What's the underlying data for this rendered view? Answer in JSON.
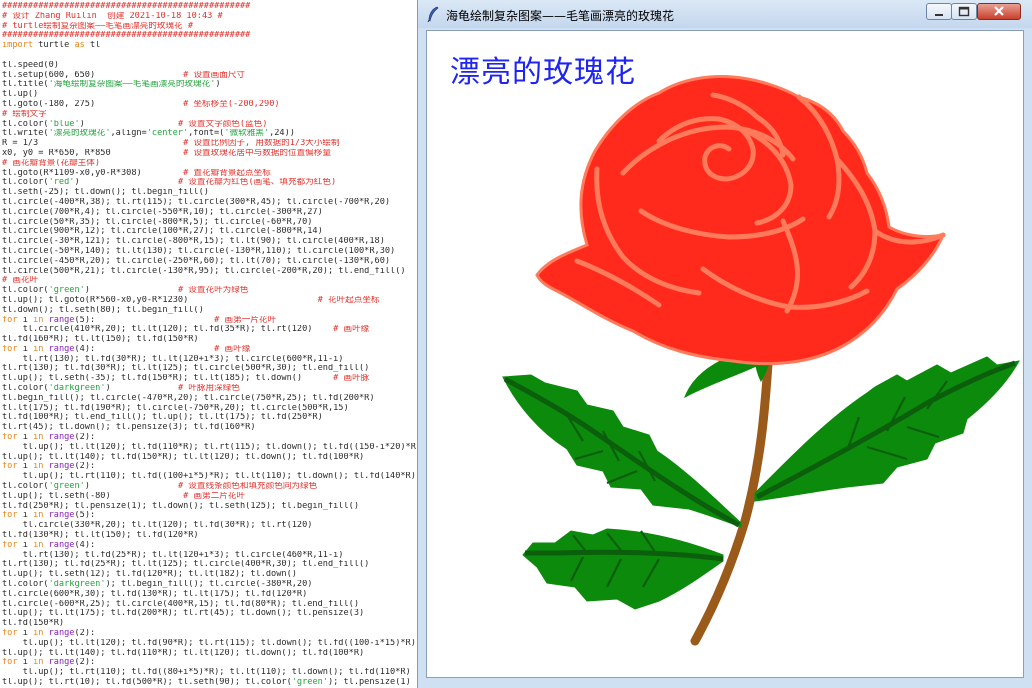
{
  "editor": {
    "lines": [
      [
        [
          "c",
          "################################################"
        ]
      ],
      [
        [
          "c",
          "# 设计 Zhang Ruilin  创建 2021-10-18 10:43 #"
        ]
      ],
      [
        [
          "c",
          "# turtle绘制复杂图案——毛笔画漂亮的玫瑰花 #"
        ]
      ],
      [
        [
          "c",
          "################################################"
        ]
      ],
      [
        [
          "k",
          "import"
        ],
        [
          "n",
          " turtle "
        ],
        [
          "k",
          "as"
        ],
        [
          "n",
          " tl"
        ]
      ],
      [
        [
          "n",
          ""
        ]
      ],
      [
        [
          "n",
          "tl.speed(0)"
        ]
      ],
      [
        [
          "n",
          "tl.setup(600, 650)                 "
        ],
        [
          "c",
          "# 设置画面尺寸"
        ]
      ],
      [
        [
          "n",
          "tl.title("
        ],
        [
          "s",
          "'海龟绘制复杂图案——毛笔画漂亮的玫瑰花'"
        ],
        [
          "n",
          ")"
        ]
      ],
      [
        [
          "n",
          "tl.up()"
        ]
      ],
      [
        [
          "n",
          "tl.goto(-180, 275)                 "
        ],
        [
          "c",
          "# 坐标移至(-200,290)"
        ]
      ],
      [
        [
          "c",
          "# 绘制文字"
        ]
      ],
      [
        [
          "n",
          "tl.color("
        ],
        [
          "s",
          "'blue'"
        ],
        [
          "n",
          ")                  "
        ],
        [
          "c",
          "# 设置文字颜色(蓝色)"
        ]
      ],
      [
        [
          "n",
          "tl.write("
        ],
        [
          "s",
          "'漂亮的玫瑰花'"
        ],
        [
          "n",
          ",align="
        ],
        [
          "s",
          "'center'"
        ],
        [
          "n",
          ",font=("
        ],
        [
          "s",
          "'微软雅黑'"
        ],
        [
          "n",
          ",24))"
        ]
      ],
      [
        [
          "n",
          "R = 1/3                            "
        ],
        [
          "c",
          "# 设置比例因子, 用数据的1/3大小绘制"
        ]
      ],
      [
        [
          "n",
          "x0, y0 = R*650, R*850              "
        ],
        [
          "c",
          "# 设置玫瑰花居中与数据的位置偏移量"
        ]
      ],
      [
        [
          "c",
          "# 画花瓣背景(花瓣主体)"
        ]
      ],
      [
        [
          "n",
          "tl.goto(R*1109-x0,y0-R*308)        "
        ],
        [
          "c",
          "# 置花瓣背景起点坐标"
        ]
      ],
      [
        [
          "n",
          "tl.color("
        ],
        [
          "s",
          "'red'"
        ],
        [
          "n",
          ")                   "
        ],
        [
          "c",
          "# 设置花瓣为红色(画笔、填充都为红色)"
        ]
      ],
      [
        [
          "n",
          "tl.seth(-25); tl.down(); tl.begin_fill()"
        ]
      ],
      [
        [
          "n",
          "tl.circle(-400*R,38); tl.rt(115); tl.circle(300*R,45); tl.circle(-700*R,20)"
        ]
      ],
      [
        [
          "n",
          "tl.circle(700*R,4); tl.circle(-550*R,10); tl.circle(-300*R,27)"
        ]
      ],
      [
        [
          "n",
          "tl.circle(50*R,35); tl.circle(-800*R,5); tl.circle(-60*R,70)"
        ]
      ],
      [
        [
          "n",
          "tl.circle(900*R,12); tl.circle(100*R,27); tl.circle(-800*R,14)"
        ]
      ],
      [
        [
          "n",
          "tl.circle(-30*R,121); tl.circle(-800*R,15); tl.lt(90); tl.circle(400*R,18)"
        ]
      ],
      [
        [
          "n",
          "tl.circle(-50*R,140); tl.lt(130); tl.circle(-130*R,110); tl.circle(100*R,30)"
        ]
      ],
      [
        [
          "n",
          "tl.circle(-450*R,20); tl.circle(-250*R,60); tl.lt(70); tl.circle(-130*R,60)"
        ]
      ],
      [
        [
          "n",
          "tl.circle(500*R,21); tl.circle(-130*R,95); tl.circle(-200*R,20); tl.end_fill()"
        ]
      ],
      [
        [
          "c",
          "# 画花叶"
        ]
      ],
      [
        [
          "n",
          "tl.color("
        ],
        [
          "s",
          "'green'"
        ],
        [
          "n",
          ")                 "
        ],
        [
          "c",
          "# 设置花叶为绿色"
        ]
      ],
      [
        [
          "n",
          "tl.up(); tl.goto(R*560-x0,y0-R*1230)                         "
        ],
        [
          "c",
          "# 花叶起点坐标"
        ]
      ],
      [
        [
          "n",
          "tl.down(); tl.seth(80); tl.begin_fill()"
        ]
      ],
      [
        [
          "k",
          "for"
        ],
        [
          "n",
          " i "
        ],
        [
          "k",
          "in"
        ],
        [
          "p",
          " range"
        ],
        [
          "n",
          "(5):                       "
        ],
        [
          "c",
          "# 画第一片花叶"
        ]
      ],
      [
        [
          "n",
          "    tl.circle(410*R,20); tl.lt(120); tl.fd(35*R); tl.rt(120)    "
        ],
        [
          "c",
          "# 画叶缘"
        ]
      ],
      [
        [
          "n",
          "tl.fd(160*R); tl.lt(150); tl.fd(150*R)"
        ]
      ],
      [
        [
          "k",
          "for"
        ],
        [
          "n",
          " i "
        ],
        [
          "k",
          "in"
        ],
        [
          "p",
          " range"
        ],
        [
          "n",
          "(4):                       "
        ],
        [
          "c",
          "# 画叶缘"
        ]
      ],
      [
        [
          "n",
          "    tl.rt(130); tl.fd(30*R); tl.lt(120+i*3); tl.circle(600*R,11-i)"
        ]
      ],
      [
        [
          "n",
          "tl.rt(130); tl.fd(30*R); tl.lt(125); tl.circle(500*R,30); tl.end_fill()"
        ]
      ],
      [
        [
          "n",
          "tl.up(); tl.seth(-35); tl.fd(150*R); tl.lt(185); tl.down()      "
        ],
        [
          "c",
          "# 画叶脉"
        ]
      ],
      [
        [
          "n",
          "tl.color("
        ],
        [
          "s",
          "'darkgreen'"
        ],
        [
          "n",
          ")             "
        ],
        [
          "c",
          "# 叶脉用深绿色"
        ]
      ],
      [
        [
          "n",
          "tl.begin_fill(); tl.circle(-470*R,20); tl.circle(750*R,25); tl.fd(200*R)"
        ]
      ],
      [
        [
          "n",
          "tl.lt(175); tl.fd(190*R); tl.circle(-750*R,20); tl.circle(500*R,15)"
        ]
      ],
      [
        [
          "n",
          "tl.fd(100*R); tl.end_fill(); tl.up(); tl.lt(175); tl.fd(250*R)"
        ]
      ],
      [
        [
          "n",
          "tl.rt(45); tl.down(); tl.pensize(3); tl.fd(160*R)"
        ]
      ],
      [
        [
          "k",
          "for"
        ],
        [
          "n",
          " i "
        ],
        [
          "k",
          "in"
        ],
        [
          "p",
          " range"
        ],
        [
          "n",
          "(2):"
        ]
      ],
      [
        [
          "n",
          "    tl.up(); tl.lt(120); tl.fd(110*R); tl.rt(115); tl.down(); tl.fd((150-i*20)*R)"
        ]
      ],
      [
        [
          "n",
          "tl.up(); tl.lt(140); tl.fd(150*R); tl.lt(120); tl.down(); tl.fd(100*R)"
        ]
      ],
      [
        [
          "k",
          "for"
        ],
        [
          "n",
          " i "
        ],
        [
          "k",
          "in"
        ],
        [
          "p",
          " range"
        ],
        [
          "n",
          "(2):"
        ]
      ],
      [
        [
          "n",
          "    tl.up(); tl.rt(110); tl.fd((100+i*5)*R); tl.lt(110); tl.down(); tl.fd(140*R)"
        ]
      ],
      [
        [
          "n",
          "tl.color("
        ],
        [
          "s",
          "'green'"
        ],
        [
          "n",
          ")                 "
        ],
        [
          "c",
          "# 设置线条颜色和填充颜色同为绿色"
        ]
      ],
      [
        [
          "n",
          "tl.up(); tl.seth(-80)              "
        ],
        [
          "c",
          "# 画第二片花叶"
        ]
      ],
      [
        [
          "n",
          "tl.fd(250*R); tl.pensize(1); tl.down(); tl.seth(125); tl.begin_fill()"
        ]
      ],
      [
        [
          "k",
          "for"
        ],
        [
          "n",
          " i "
        ],
        [
          "k",
          "in"
        ],
        [
          "p",
          " range"
        ],
        [
          "n",
          "(5):"
        ]
      ],
      [
        [
          "n",
          "    tl.circle(330*R,20); tl.lt(120); tl.fd(30*R); tl.rt(120)"
        ]
      ],
      [
        [
          "n",
          "tl.fd(130*R); tl.lt(150); tl.fd(120*R)"
        ]
      ],
      [
        [
          "k",
          "for"
        ],
        [
          "n",
          " i "
        ],
        [
          "k",
          "in"
        ],
        [
          "p",
          " range"
        ],
        [
          "n",
          "(4):"
        ]
      ],
      [
        [
          "n",
          "    tl.rt(130); tl.fd(25*R); tl.lt(120+i*3); tl.circle(460*R,11-i)"
        ]
      ],
      [
        [
          "n",
          "tl.rt(130); tl.fd(25*R); tl.lt(125); tl.circle(400*R,30); tl.end_fill()"
        ]
      ],
      [
        [
          "n",
          "tl.up(); tl.seth(12); tl.fd(120*R); tl.lt(182); tl.down()"
        ]
      ],
      [
        [
          "n",
          "tl.color("
        ],
        [
          "s",
          "'darkgreen'"
        ],
        [
          "n",
          "); tl.begin_fill(); tl.circle(-380*R,20)"
        ]
      ],
      [
        [
          "n",
          "tl.circle(600*R,30); tl.fd(130*R); tl.lt(175); tl.fd(120*R)"
        ]
      ],
      [
        [
          "n",
          "tl.circle(-600*R,25); tl.circle(400*R,15); tl.fd(80*R); tl.end_fill()"
        ]
      ],
      [
        [
          "n",
          "tl.up(); tl.lt(175); tl.fd(200*R); tl.rt(45); tl.down(); tl.pensize(3)"
        ]
      ],
      [
        [
          "n",
          "tl.fd(150*R)"
        ]
      ],
      [
        [
          "k",
          "for"
        ],
        [
          "n",
          " i "
        ],
        [
          "k",
          "in"
        ],
        [
          "p",
          " range"
        ],
        [
          "n",
          "(2):"
        ]
      ],
      [
        [
          "n",
          "    tl.up(); tl.lt(120); tl.fd(90*R); tl.rt(115); tl.down(); tl.fd((100-i*15)*R)"
        ]
      ],
      [
        [
          "n",
          "tl.up(); tl.lt(140); tl.fd(110*R); tl.lt(120); tl.down(); tl.fd(100*R)"
        ]
      ],
      [
        [
          "k",
          "for"
        ],
        [
          "n",
          " i "
        ],
        [
          "k",
          "in"
        ],
        [
          "p",
          " range"
        ],
        [
          "n",
          "(2):"
        ]
      ],
      [
        [
          "n",
          "    tl.up(); tl.rt(110); tl.fd((80+i*5)*R); tl.lt(110); tl.down(); tl.fd(110*R)"
        ]
      ],
      [
        [
          "n",
          "tl.up(); tl.rt(10); tl.fd(500*R); tl.seth(90); tl.color("
        ],
        [
          "s",
          "'green'"
        ],
        [
          "n",
          "); tl.pensize(1)"
        ]
      ]
    ]
  },
  "window": {
    "title": "海龟绘制复杂图案——毛笔画漂亮的玫瑰花",
    "icon": "feather-icon",
    "buttons": [
      "minimize",
      "maximize",
      "close"
    ]
  },
  "canvas": {
    "heading": "漂亮的玫瑰花",
    "heading_color": "#1f24f0",
    "petal_color": "#ff2a1c",
    "petal_outline": "#ff7b5c",
    "leaf_color": "#0c8a0c",
    "vein_color": "#0b5e0b",
    "stem_color": "#9a5a1a"
  }
}
